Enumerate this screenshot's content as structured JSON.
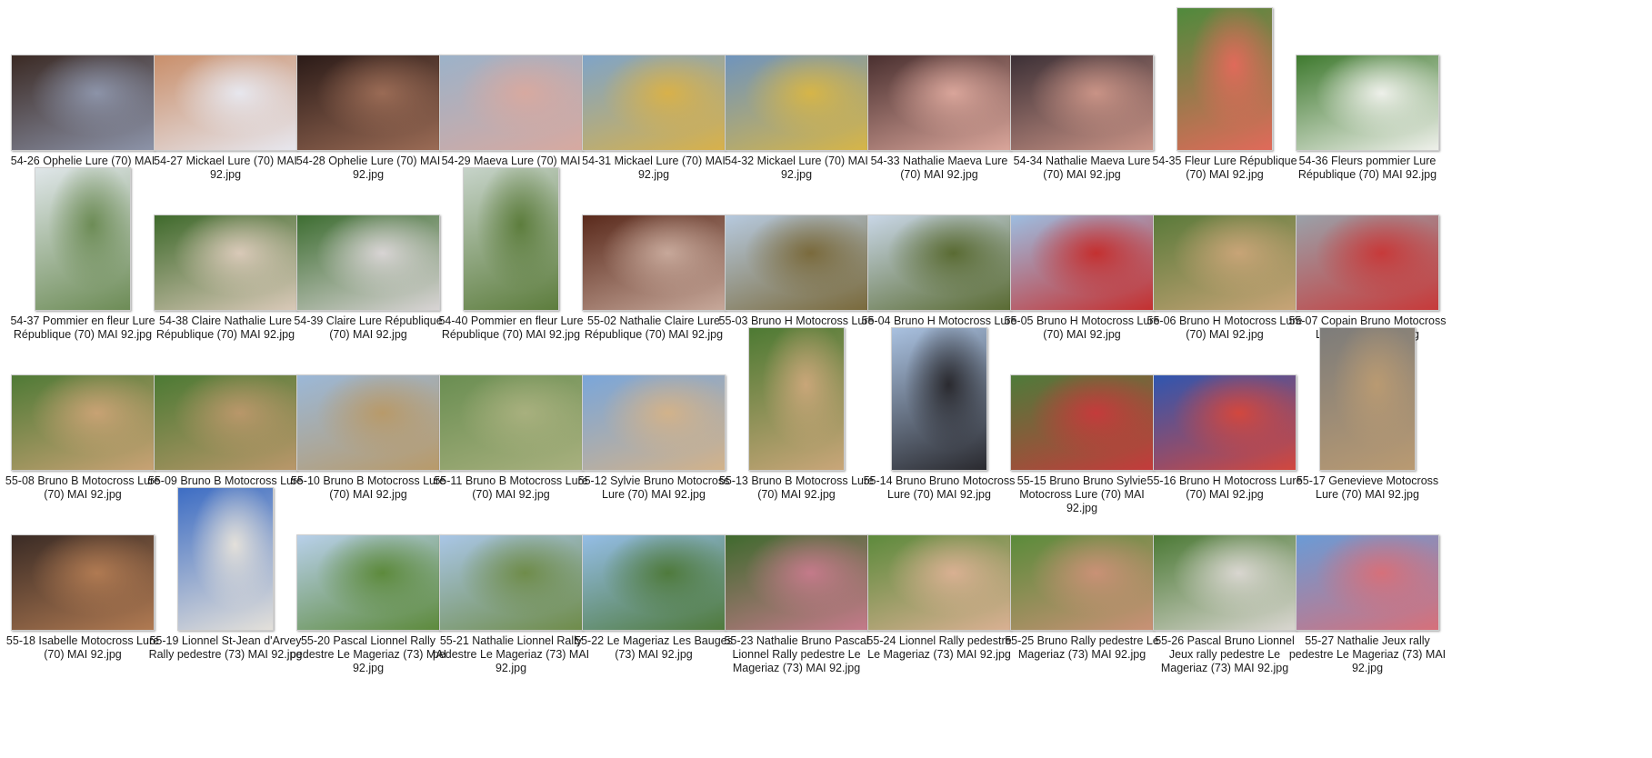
{
  "items": [
    {
      "label": "54-26 Ophelie Lure (70) MAI 92.jpg",
      "o": "l",
      "c1": "#3b2a24",
      "c2": "#8c93a8"
    },
    {
      "label": "54-27 Mickael Lure (70) MAI 92.jpg",
      "o": "l",
      "c1": "#c98f6b",
      "c2": "#e7e7ee"
    },
    {
      "label": "54-28 Ophelie Lure (70) MAI 92.jpg",
      "o": "l",
      "c1": "#2b1b18",
      "c2": "#9a6b55"
    },
    {
      "label": "54-29 Maeva Lure (70) MAI 92.jpg",
      "o": "l",
      "c1": "#9cb2c9",
      "c2": "#d7a9a0"
    },
    {
      "label": "54-31 Mickael Lure (70) MAI 92.jpg",
      "o": "l",
      "c1": "#7fa4c8",
      "c2": "#d8b14a"
    },
    {
      "label": "54-32 Mickael Lure (70) MAI 92.jpg",
      "o": "l",
      "c1": "#6f94bd",
      "c2": "#d6b548"
    },
    {
      "label": "54-33 Nathalie Maeva Lure (70) MAI 92.jpg",
      "o": "l",
      "c1": "#4a3030",
      "c2": "#d9a59a"
    },
    {
      "label": "54-34 Nathalie Maeva Lure (70) MAI 92.jpg",
      "o": "l",
      "c1": "#3c3036",
      "c2": "#c99386"
    },
    {
      "label": "54-35 Fleur Lure République (70) MAI 92.jpg",
      "o": "p",
      "c1": "#4f8a3c",
      "c2": "#e06a5a"
    },
    {
      "label": "54-36 Fleurs pommier Lure République (70) MAI 92.jpg",
      "o": "l",
      "c1": "#3f7a2f",
      "c2": "#eef0ea"
    },
    {
      "label": "54-37 Pommier en fleur Lure République (70) MAI 92.jpg",
      "o": "p",
      "c1": "#dfe6e9",
      "c2": "#6d8c56"
    },
    {
      "label": "54-38 Claire Nathalie Lure République (70) MAI 92.jpg",
      "o": "l",
      "c1": "#3f6a2c",
      "c2": "#d9c9b8"
    },
    {
      "label": "54-39 Claire Lure République (70) MAI 92.jpg",
      "o": "l",
      "c1": "#3e6e32",
      "c2": "#d8d4d4"
    },
    {
      "label": "54-40 Pommier en fleur Lure République (70) MAI 92.jpg",
      "o": "p",
      "c1": "#c6d3c9",
      "c2": "#5d7d3d"
    },
    {
      "label": "55-02 Nathalie Claire Lure République (70) MAI 92.jpg",
      "o": "l",
      "c1": "#5a2a1c",
      "c2": "#c7a89a"
    },
    {
      "label": "55-03 Bruno H Motocross Lure (70) MAI 92.jpg",
      "o": "l",
      "c1": "#b6c9de",
      "c2": "#7a6a3c"
    },
    {
      "label": "55-04 Bruno H Motocross Lure (70) MAI 92.jpg",
      "o": "l",
      "c1": "#c8d6e6",
      "c2": "#5a6b33"
    },
    {
      "label": "55-05 Bruno H Motocross Lure (70) MAI 92.jpg",
      "o": "l",
      "c1": "#9dbde0",
      "c2": "#c43030"
    },
    {
      "label": "55-06 Bruno H Motocross Lure (70) MAI 92.jpg",
      "o": "l",
      "c1": "#5a7a3a",
      "c2": "#c8a477"
    },
    {
      "label": "55-07 Copain Bruno Motocross Lure (70) MAI 92.jpg",
      "o": "l",
      "c1": "#9aa1a9",
      "c2": "#c73a3a"
    },
    {
      "label": "55-08 Bruno B Motocross Lure (70) MAI 92.jpg",
      "o": "l",
      "c1": "#4f7a36",
      "c2": "#c8a274"
    },
    {
      "label": "55-09 Bruno B Motocross Lure (70) MAI 92.jpg",
      "o": "l",
      "c1": "#4c7a34",
      "c2": "#b9976a"
    },
    {
      "label": "55-10 Bruno B Motocross Lure (70) MAI 92.jpg",
      "o": "l",
      "c1": "#9bb8d8",
      "c2": "#b89a6a"
    },
    {
      "label": "55-11 Bruno B Motocross Lure (70) MAI 92.jpg",
      "o": "l",
      "c1": "#6a8e52",
      "c2": "#a8b07e"
    },
    {
      "label": "55-12 Sylvie Bruno Motocross Lure (70) MAI 92.jpg",
      "o": "l",
      "c1": "#7aa6da",
      "c2": "#d2b28a"
    },
    {
      "label": "55-13 Bruno B Motocross Lure (70) MAI 92.jpg",
      "o": "p",
      "c1": "#4d7a33",
      "c2": "#c9a679"
    },
    {
      "label": "55-14 Bruno Bruno Motocross Lure (70) MAI 92.jpg",
      "o": "p",
      "c1": "#a9c1e0",
      "c2": "#2a2a2f"
    },
    {
      "label": "55-15 Bruno Bruno Sylvie Motocross Lure (70) MAI 92.jpg",
      "o": "l",
      "c1": "#4e7b3a",
      "c2": "#c43b3b"
    },
    {
      "label": "55-16 Bruno H Motocross Lure (70) MAI 92.jpg",
      "o": "l",
      "c1": "#2f56b0",
      "c2": "#d2473e"
    },
    {
      "label": "55-17 Genevieve Motocross Lure (70) MAI 92.jpg",
      "o": "p",
      "c1": "#7d7c7a",
      "c2": "#b99a72"
    },
    {
      "label": "55-18 Isabelle Motocross Lure (70) MAI 92.jpg",
      "o": "l",
      "c1": "#3a2b25",
      "c2": "#b07a52"
    },
    {
      "label": "55-19 Lionnel St-Jean d'Arvey Rally pedestre (73) MAI 92.jpg",
      "o": "p",
      "c1": "#3d6dc4",
      "c2": "#e3e0da"
    },
    {
      "label": "55-20 Pascal Lionnel Rally pedestre Le Mageriaz (73) MAI 92.jpg",
      "o": "l",
      "c1": "#b8d0ea",
      "c2": "#5d8a3c"
    },
    {
      "label": "55-21 Nathalie Lionnel Rally pedestre Le Mageriaz (73) MAI 92.jpg",
      "o": "l",
      "c1": "#a9c6e6",
      "c2": "#6f8c4a"
    },
    {
      "label": "55-22 Le Mageriaz Les Bauges (73) MAI 92.jpg",
      "o": "l",
      "c1": "#94bde6",
      "c2": "#4f7a3c"
    },
    {
      "label": "55-23 Nathalie Bruno Pascal Lionnel Rally pedestre Le Mageriaz (73) MAI 92.jpg",
      "o": "l",
      "c1": "#3f6a2e",
      "c2": "#c47a8a"
    },
    {
      "label": "55-24 Lionnel Rally pedestre Le Mageriaz (73) MAI 92.jpg",
      "o": "l",
      "c1": "#5d8a3c",
      "c2": "#d9b092"
    },
    {
      "label": "55-25 Bruno Rally pedestre Le Mageriaz (73) MAI 92.jpg",
      "o": "l",
      "c1": "#5a8b3a",
      "c2": "#c99176"
    },
    {
      "label": "55-26 Pascal Bruno Lionnel Jeux rally pedestre Le Mageriaz (73) MAI 92.jpg",
      "o": "l",
      "c1": "#4c7a36",
      "c2": "#d9d6d0"
    },
    {
      "label": "55-27 Nathalie Jeux rally pedestre Le Mageriaz (73) MAI 92.jpg",
      "o": "l",
      "c1": "#6a9bd6",
      "c2": "#d6707a"
    }
  ]
}
